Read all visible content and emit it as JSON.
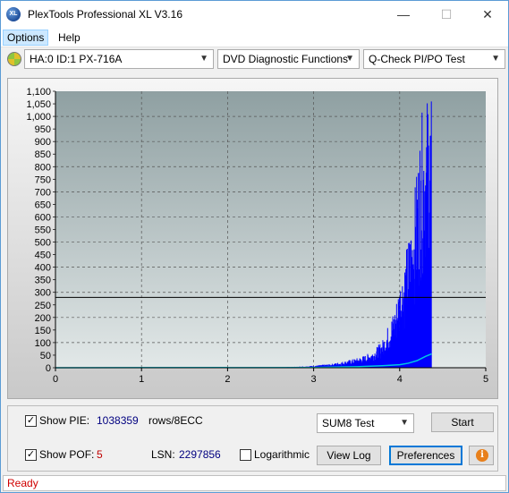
{
  "window": {
    "title": "PlexTools Professional XL V3.16",
    "icon_text": "XL",
    "minimize": "—",
    "maximize": "☐",
    "close": "✕"
  },
  "menu": {
    "options": "Options",
    "help": "Help"
  },
  "toolbar": {
    "drive": "HA:0 ID:1  PX-716A",
    "function": "DVD Diagnostic Functions",
    "test": "Q-Check PI/PO Test"
  },
  "chart_data": {
    "type": "bar",
    "xlabel": "",
    "ylabel": "",
    "xlim": [
      0,
      5
    ],
    "ylim": [
      0,
      1100
    ],
    "x_ticks": [
      "0",
      "1",
      "2",
      "3",
      "4",
      "5"
    ],
    "y_ticks": [
      "0",
      "50",
      "100",
      "150",
      "200",
      "250",
      "300",
      "350",
      "400",
      "450",
      "500",
      "550",
      "600",
      "650",
      "700",
      "750",
      "800",
      "850",
      "900",
      "950",
      "1,000",
      "1,050",
      "1,100"
    ],
    "threshold_line": 280,
    "grid": true,
    "series": [
      {
        "color": "#0000ff",
        "x": [
          2.6,
          2.8,
          3.0,
          3.1,
          3.2,
          3.3,
          3.4,
          3.5,
          3.6,
          3.7,
          3.8,
          3.9,
          3.95,
          4.0,
          4.05,
          4.1,
          4.15,
          4.2,
          4.25,
          4.3,
          4.35,
          4.37
        ],
        "values": [
          2,
          4,
          8,
          12,
          15,
          22,
          30,
          38,
          50,
          70,
          110,
          200,
          250,
          350,
          420,
          520,
          620,
          800,
          1000,
          1080,
          1100,
          1080
        ]
      },
      {
        "color": "#00c8e0",
        "x": [
          0,
          3.0,
          3.5,
          3.8,
          4.0,
          4.1,
          4.2,
          4.3,
          4.37
        ],
        "values": [
          0,
          1,
          4,
          8,
          12,
          18,
          28,
          45,
          55
        ]
      }
    ]
  },
  "controls": {
    "show_pie_label": "Show PIE:",
    "pie_value": "1038359",
    "pie_unit": "rows/8ECC",
    "show_pof_label": "Show POF:",
    "pof_value": "5",
    "lsn_label": "LSN:",
    "lsn_value": "2297856",
    "logarithmic_label": "Logarithmic",
    "sum_select": "SUM8 Test",
    "start_button": "Start",
    "viewlog_button": "View Log",
    "preferences_button": "Preferences",
    "info_glyph": "i",
    "show_pie_checked": true,
    "show_pof_checked": true,
    "logarithmic_checked": false
  },
  "status": {
    "text": "Ready"
  }
}
